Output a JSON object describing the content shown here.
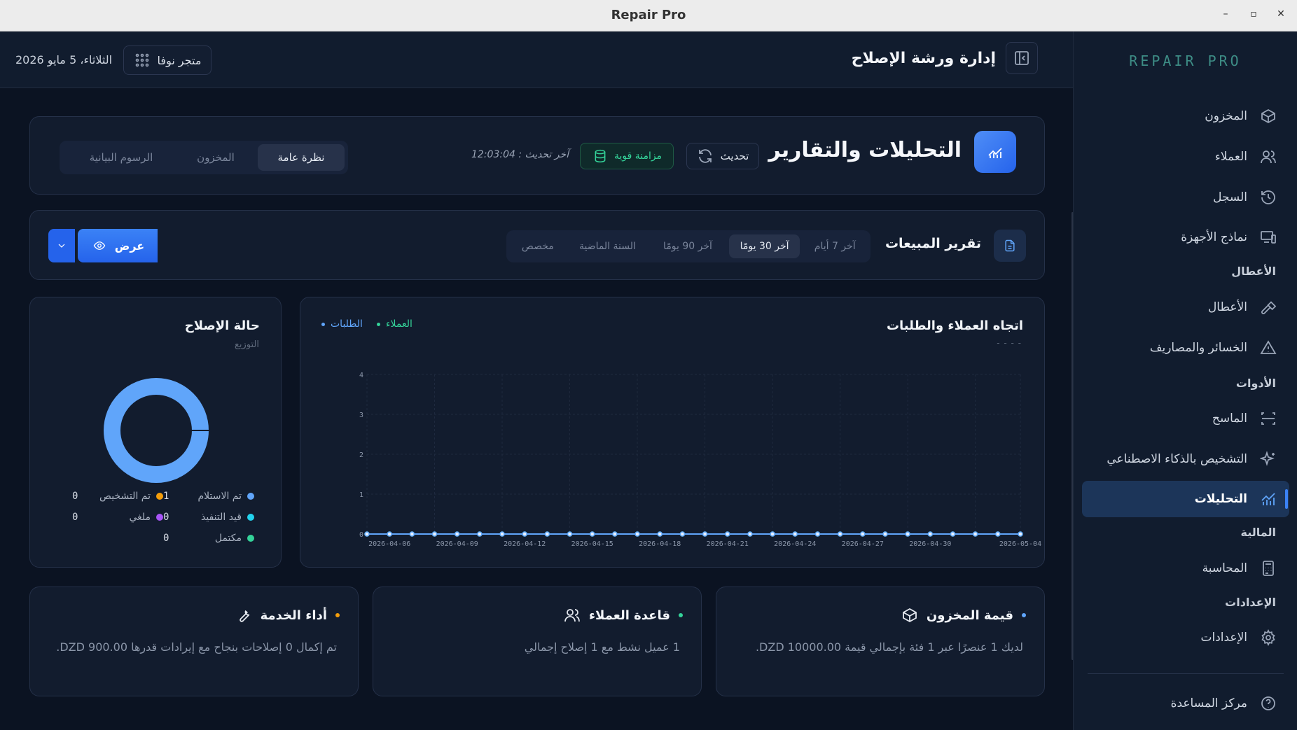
{
  "window": {
    "title": "Repair Pro",
    "controls": [
      "–",
      "▫",
      "✕"
    ]
  },
  "header": {
    "page_title": "إدارة ورشة الإصلاح",
    "date": "الثلاثاء، 5 مايو 2026",
    "store_label": "متجر نوفا"
  },
  "sidebar": {
    "logo": "REPAIR PRO",
    "items": [
      {
        "label": "المخزون",
        "icon": "box-icon"
      },
      {
        "label": "العملاء",
        "icon": "users-icon"
      },
      {
        "label": "السجل",
        "icon": "history-icon"
      },
      {
        "label": "نماذج الأجهزة",
        "icon": "devices-icon"
      }
    ],
    "section_faults": "الأعطال",
    "faults_items": [
      {
        "label": "الأعطال",
        "icon": "hammer-icon"
      },
      {
        "label": "الخسائر والمصاريف",
        "icon": "warning-icon"
      }
    ],
    "section_tools": "الأدوات",
    "tools_items": [
      {
        "label": "الماسح",
        "icon": "scan-icon"
      },
      {
        "label": "التشخيص بالذكاء الاصطناعي",
        "icon": "sparkles-icon"
      },
      {
        "label": "التحليلات",
        "icon": "chart-icon"
      }
    ],
    "section_finance": "المالية",
    "finance_items": [
      {
        "label": "المحاسبة",
        "icon": "calculator-icon"
      }
    ],
    "section_settings": "الإعدادات",
    "settings_items": [
      {
        "label": "الإعدادات",
        "icon": "gear-icon"
      }
    ],
    "help": "مركز المساعدة"
  },
  "analytics": {
    "title": "التحليلات والتقارير",
    "refresh_label": "تحديث",
    "sync_label": "مزامنة قوية",
    "last_update": "آخر تحديث : 12:03:04",
    "tabs": [
      "نظرة عامة",
      "المخزون",
      "الرسوم البيانية"
    ],
    "active_tab": "نظرة عامة"
  },
  "sales_report": {
    "title": "تقرير المبيعات",
    "ranges": [
      "آخر 7 أيام",
      "آخر 30 يومًا",
      "آخر 90 يومًا",
      "السنة الماضية",
      "مخصص"
    ],
    "active_range": "آخر 30 يومًا",
    "view_label": "عرض"
  },
  "trend_chart": {
    "title": "اتجاه العملاء والطلبات",
    "subtitle": "- - - -",
    "legend_customers": "العملاء",
    "legend_orders": "الطلبات"
  },
  "chart_data": {
    "type": "line",
    "title": "اتجاه العملاء والطلبات",
    "x": [
      "2026-04-05",
      "2026-04-06",
      "2026-04-07",
      "2026-04-08",
      "2026-04-09",
      "2026-04-10",
      "2026-04-11",
      "2026-04-12",
      "2026-04-13",
      "2026-04-14",
      "2026-04-15",
      "2026-04-16",
      "2026-04-17",
      "2026-04-18",
      "2026-04-19",
      "2026-04-20",
      "2026-04-21",
      "2026-04-22",
      "2026-04-23",
      "2026-04-24",
      "2026-04-25",
      "2026-04-26",
      "2026-04-27",
      "2026-04-28",
      "2026-04-29",
      "2026-04-30",
      "2026-05-01",
      "2026-05-02",
      "2026-05-03",
      "2026-05-04"
    ],
    "x_tick_labels": [
      "2026-04-06",
      "2026-04-09",
      "2026-04-12",
      "2026-04-15",
      "2026-04-18",
      "2026-04-21",
      "2026-04-24",
      "2026-04-27",
      "2026-04-30",
      "2026-05-04"
    ],
    "series": [
      {
        "name": "العملاء",
        "color": "#34d399",
        "values": [
          0,
          0,
          0,
          0,
          0,
          0,
          0,
          0,
          0,
          0,
          0,
          0,
          0,
          0,
          0,
          0,
          0,
          0,
          0,
          0,
          0,
          0,
          0,
          0,
          0,
          0,
          0,
          0,
          0,
          0
        ]
      },
      {
        "name": "الطلبات",
        "color": "#60a5fa",
        "values": [
          0,
          0,
          0,
          0,
          0,
          0,
          0,
          0,
          0,
          0,
          0,
          0,
          0,
          0,
          0,
          0,
          0,
          0,
          0,
          0,
          0,
          0,
          0,
          0,
          0,
          0,
          0,
          0,
          0,
          0
        ]
      }
    ],
    "y_ticks": [
      0,
      1,
      2,
      3,
      4
    ],
    "ylim": [
      0,
      4
    ],
    "grid": true,
    "legend": "top-left"
  },
  "repair_status": {
    "title": "حالة الإصلاح",
    "subtitle": "التوزيع",
    "legend": [
      {
        "label": "تم الاستلام",
        "value": "1",
        "color": "#60a5fa"
      },
      {
        "label": "تم التشخيص",
        "value": "0",
        "color": "#f59e0b"
      },
      {
        "label": "قيد التنفيذ",
        "value": "0",
        "color": "#22d3ee"
      },
      {
        "label": "ملغي",
        "value": "0",
        "color": "#a855f7"
      },
      {
        "label": "مكتمل",
        "value": "0",
        "color": "#34d399"
      }
    ]
  },
  "stats": {
    "inventory": {
      "title": "قيمة المخزون",
      "dot": "#60a5fa",
      "desc": "لديك 1 عنصرًا عبر 1 فئة بإجمالي قيمة 10000.00 DZD."
    },
    "customers": {
      "title": "قاعدة العملاء",
      "dot": "#34d399",
      "desc": "1 عميل نشط مع 1 إصلاح إجمالي"
    },
    "service": {
      "title": "أداء الخدمة",
      "dot": "#f59e0b",
      "desc": "تم إكمال 0 إصلاحات بنجاح مع إيرادات قدرها 900.00 DZD."
    }
  },
  "colors": {
    "accent": "#3b82f6",
    "sync_green": "#34d399"
  }
}
